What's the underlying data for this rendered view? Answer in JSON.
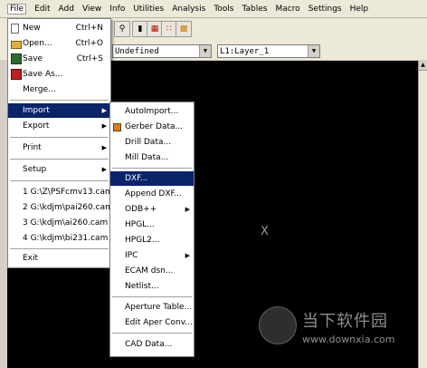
{
  "menubar": [
    "File",
    "Edit",
    "Add",
    "View",
    "Info",
    "Utilities",
    "Analysis",
    "Tools",
    "Tables",
    "Macro",
    "Settings",
    "Help"
  ],
  "toolbar": {
    "dcode_combo": "Undefined",
    "layer_combo": "L1:Layer_1"
  },
  "file_menu": {
    "items": [
      {
        "label": "New",
        "shortcut": "Ctrl+N",
        "icon": "new-file-icon"
      },
      {
        "label": "Open...",
        "shortcut": "Ctrl+O",
        "icon": "open-folder-icon"
      },
      {
        "label": "Save",
        "shortcut": "Ctrl+S",
        "icon": "save-disk-icon"
      },
      {
        "label": "Save As...",
        "shortcut": "",
        "icon": "save-as-icon"
      },
      {
        "label": "Merge...",
        "shortcut": ""
      },
      {
        "label": "Import",
        "submenu": true
      },
      {
        "label": "Export",
        "submenu": true
      },
      {
        "label": "Print",
        "submenu": true
      },
      {
        "label": "Setup",
        "submenu": true
      },
      {
        "label": "1 G:\\Z\\PSFcmv13.cam"
      },
      {
        "label": "2 G:\\kdjm\\pai260.cam"
      },
      {
        "label": "3 G:\\kdjm\\ai260.cam"
      },
      {
        "label": "4 G:\\kdjm\\bi231.cam"
      },
      {
        "label": "Exit"
      }
    ]
  },
  "import_menu": {
    "items": [
      "AutoImport...",
      "Gerber Data...",
      "Drill Data...",
      "Mill Data...",
      "DXF...",
      "Append DXF...",
      "ODB++",
      "HPGL...",
      "HPGL2...",
      "IPC",
      "ECAM dsn...",
      "Netlist...",
      "Aperture Table...",
      "Edit Aper Conv...",
      "CAD Data..."
    ]
  },
  "canvas": {
    "marker": "X"
  },
  "watermark": {
    "title": "当下软件园",
    "url": "www.downxia.com"
  },
  "colors": {
    "highlight": "#0a246a",
    "canvas": "#000000",
    "menu_bg": "#ffffff"
  }
}
